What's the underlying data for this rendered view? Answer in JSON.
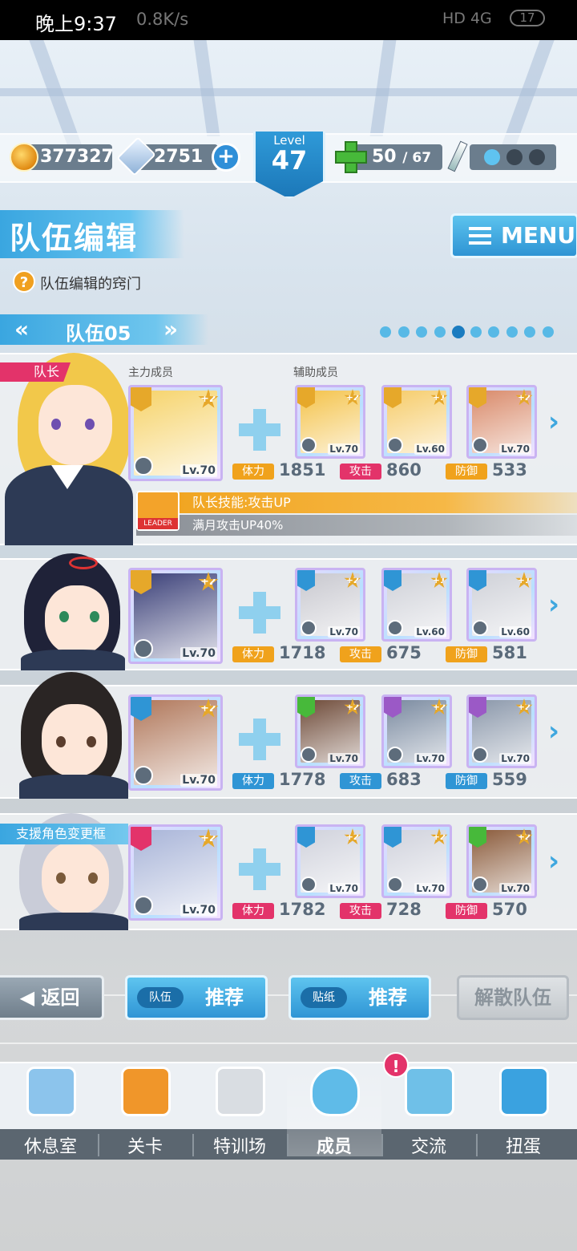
{
  "status_bar": {
    "time": "晚上9:37",
    "speed": "0.8K/s",
    "network": "HD 4G",
    "battery": "17"
  },
  "resources": {
    "coins": "377327",
    "gems": "2751",
    "level_label": "Level",
    "level": "47",
    "stamina": "50",
    "stamina_max": "/ 67"
  },
  "header": {
    "title": "队伍编辑",
    "hint": "队伍编辑的窍门",
    "menu_label": "MENU"
  },
  "team": {
    "name": "队伍05",
    "prev": "«",
    "next": "»",
    "pages": 10,
    "current_page": 5
  },
  "columns": {
    "main": "主力成员",
    "support": "辅助成员"
  },
  "tags": {
    "leader": "队长",
    "support_change": "支援角色变更框"
  },
  "leader_skill": {
    "icon_label": "LEADER",
    "name": "队长技能:攻击UP",
    "desc": "满月攻击UP40%"
  },
  "stat_labels": {
    "hp": "体力",
    "atk": "攻击",
    "def": "防御"
  },
  "rows": [
    {
      "main_lv": "Lv.70",
      "support_lv": [
        "Lv.70",
        "Lv.60",
        "Lv.70"
      ],
      "ranks": [
        "+2",
        "+2",
        "+1",
        "+2"
      ],
      "hp": "1851",
      "atk": "860",
      "def": "533"
    },
    {
      "main_lv": "Lv.70",
      "support_lv": [
        "Lv.70",
        "Lv.60",
        "Lv.60"
      ],
      "ranks": [
        "+2",
        "+2",
        "+1",
        "+1"
      ],
      "hp": "1718",
      "atk": "675",
      "def": "581"
    },
    {
      "main_lv": "Lv.70",
      "support_lv": [
        "Lv.70",
        "Lv.70",
        "Lv.70"
      ],
      "ranks": [
        "+2",
        "+2",
        "+2",
        "+2"
      ],
      "hp": "1778",
      "atk": "683",
      "def": "559"
    },
    {
      "main_lv": "Lv.70",
      "support_lv": [
        "Lv.70",
        "Lv.70",
        "Lv.70"
      ],
      "ranks": [
        "+2",
        "+2",
        "+2",
        "+2"
      ],
      "hp": "1782",
      "atk": "728",
      "def": "570"
    }
  ],
  "buttons": {
    "back": "返回",
    "team_chip": "队伍",
    "team_recommend": "推荐",
    "sticker_chip": "贴纸",
    "sticker_recommend": "推荐",
    "disband": "解散队伍"
  },
  "nav": {
    "items": [
      "休息室",
      "关卡",
      "特训场",
      "成员",
      "交流",
      "扭蛋"
    ],
    "active": "成员",
    "badge": "!"
  },
  "colors": {
    "accent": "#2f95d5",
    "hp_tag": "#f0a21c",
    "atk_tag": "#f0a21c",
    "def_tag": "#f0a21c",
    "red_tag": "#e3336a",
    "leader_band": "#f0a21c"
  }
}
